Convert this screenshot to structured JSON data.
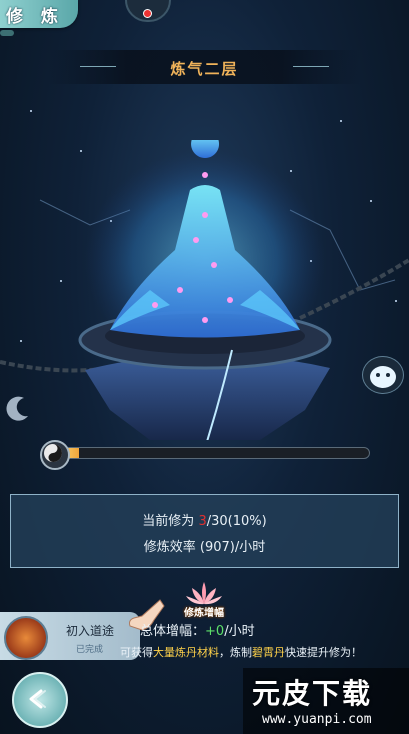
{
  "header": {
    "title": "修 炼"
  },
  "level": {
    "name": "炼气二层"
  },
  "progress": {
    "fraction": 0.06
  },
  "stats": {
    "current_label": "当前修为",
    "current_value": "3",
    "current_suffix": "/30(10%)",
    "efficiency": "修炼效率 (907)/小时"
  },
  "boost": {
    "lotus_label": "修炼增幅",
    "total_label": "总体增幅：",
    "total_value": "+0",
    "total_unit": "/小时"
  },
  "task": {
    "title": "初入道途",
    "status": "已完成"
  },
  "tip": {
    "prefix": "可获得",
    "highlight1": "大量炼丹材料",
    "middle": "，炼制",
    "highlight2": "碧霄丹",
    "suffix": "快速提升修为！"
  },
  "watermark": {
    "main": "元皮下载",
    "url": "www.yuanpi.com"
  },
  "colors": {
    "accent": "#f0b35a",
    "progress": "#f0a53a",
    "stat_red": "#e03030",
    "boost_green": "#5de06a",
    "highlight": "#ffd24a"
  },
  "icons": [
    "back-arrow-icon",
    "lotus-icon",
    "yin-yang-icon",
    "pointing-hand-icon",
    "moon-icon",
    "pet-icon"
  ]
}
